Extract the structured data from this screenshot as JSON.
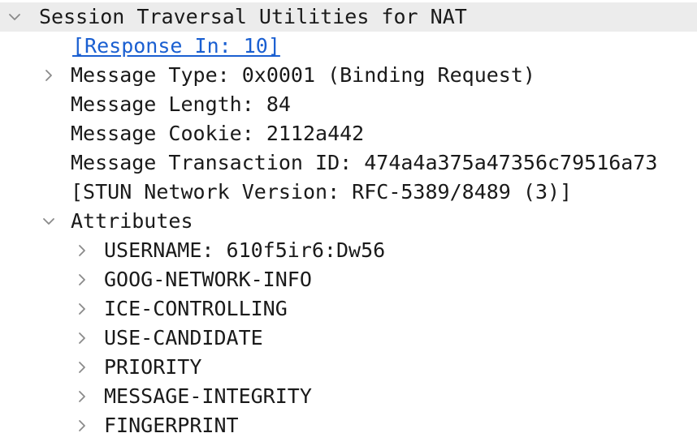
{
  "tree": {
    "root": {
      "label": "Session Traversal Utilities for NAT",
      "expanded": true,
      "icon": "chevron-down-icon"
    },
    "response_link": "[Response In: 10]",
    "message_type": {
      "label": "Message Type: 0x0001 (Binding Request)",
      "expanded": false,
      "icon": "chevron-right-icon"
    },
    "message_length": "Message Length: 84",
    "message_cookie": "Message Cookie: 2112a442",
    "transaction_id": "Message Transaction ID: 474a4a375a47356c79516a73",
    "stun_version": "[STUN Network Version: RFC-5389/8489 (3)]",
    "attributes": {
      "label": "Attributes",
      "expanded": true,
      "icon": "chevron-down-icon",
      "items": [
        {
          "label": "USERNAME: 610f5ir6:Dw56"
        },
        {
          "label": "GOOG-NETWORK-INFO"
        },
        {
          "label": "ICE-CONTROLLING"
        },
        {
          "label": "USE-CANDIDATE"
        },
        {
          "label": "PRIORITY"
        },
        {
          "label": "MESSAGE-INTEGRITY"
        },
        {
          "label": "FINGERPRINT"
        }
      ]
    }
  },
  "colors": {
    "selected_row_bg": "#ececec",
    "link": "#1a5fd1",
    "text": "#1a1a1a",
    "chevron": "#8a8a8a"
  }
}
